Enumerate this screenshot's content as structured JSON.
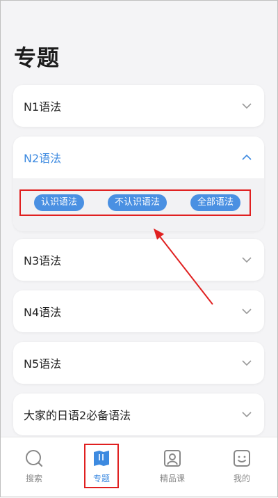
{
  "page": {
    "title": "专题"
  },
  "cards": [
    {
      "label": "N1语法",
      "expanded": false
    },
    {
      "label": "N2语法",
      "expanded": true,
      "options": [
        "认识语法",
        "不认识语法",
        "全部语法"
      ]
    },
    {
      "label": "N3语法",
      "expanded": false
    },
    {
      "label": "N4语法",
      "expanded": false
    },
    {
      "label": "N5语法",
      "expanded": false
    },
    {
      "label": "大家的日语2必备语法",
      "expanded": false
    }
  ],
  "tabbar": {
    "tabs": [
      {
        "label": "搜索",
        "icon": "search-icon",
        "active": false
      },
      {
        "label": "专题",
        "icon": "book-icon",
        "active": true
      },
      {
        "label": "精品课",
        "icon": "profile-card-icon",
        "active": false
      },
      {
        "label": "我的",
        "icon": "smile-face-icon",
        "active": false
      }
    ]
  },
  "colors": {
    "accent": "#3d8ae0",
    "pill": "#4a90e2",
    "annotation": "#e02020"
  }
}
